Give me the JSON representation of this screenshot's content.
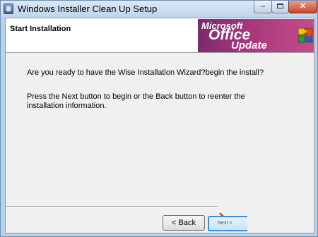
{
  "window": {
    "title": "Windows Installer Clean Up Setup"
  },
  "controls": {
    "minimize": "‒",
    "close": "✕"
  },
  "header": {
    "title": "Start Installation"
  },
  "banner": {
    "line1": "Microsoft",
    "line2": "Office",
    "line3": "Update"
  },
  "body": {
    "line1": "Are you ready to have the Wise Installation Wizard?begin the install?",
    "line2": "Press the Next button to begin or the Back button to reenter the installation information."
  },
  "buttons": {
    "back": "< Back",
    "next": "Next >"
  },
  "colors": {
    "banner_start": "#7e2a6e",
    "banner_end": "#c44d8a",
    "close_red": "#c5452a",
    "focus_blue": "#3c8fd6"
  }
}
